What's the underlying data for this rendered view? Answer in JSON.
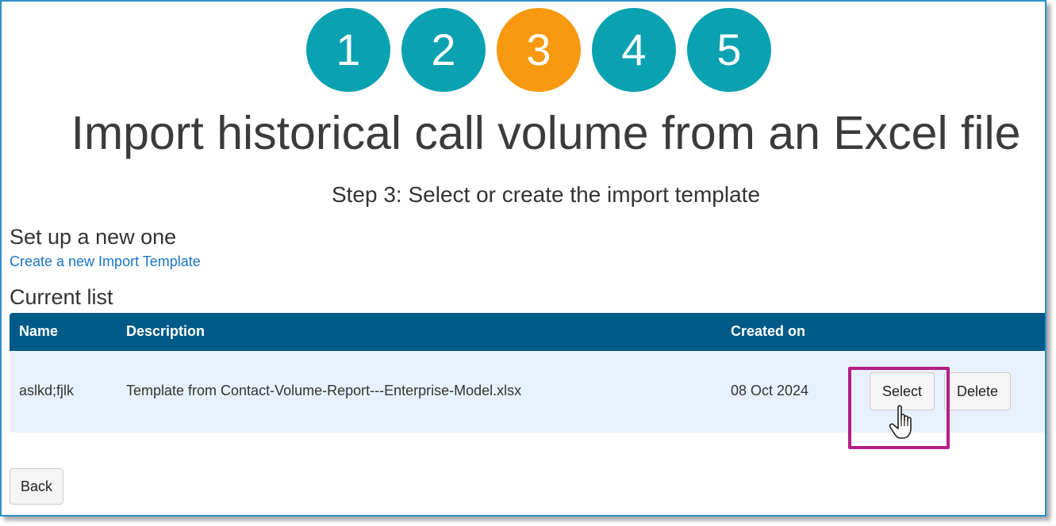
{
  "wizard": {
    "steps": [
      "1",
      "2",
      "3",
      "4",
      "5"
    ],
    "active_step": "3",
    "colors": {
      "step": "#0aa1b0",
      "active": "#f7980f"
    }
  },
  "title": "Import historical call volume from an Excel file",
  "subtitle": "Step 3: Select or create the import template",
  "new_section": {
    "heading": "Set up a new one",
    "link": "Create a new Import Template"
  },
  "list_section": {
    "heading": "Current list",
    "columns": [
      "Name",
      "Description",
      "Created on"
    ],
    "rows": [
      {
        "name": "aslkd;fjlk",
        "description": "Template from Contact-Volume-Report---Enterprise-Model.xlsx",
        "created_on": "08 Oct 2024",
        "select_label": "Select",
        "delete_label": "Delete"
      }
    ]
  },
  "back_label": "Back",
  "colors": {
    "header": "#005a87",
    "row_bg": "#e8f1fb",
    "link": "#1a73c8",
    "highlight": "#b51d86"
  },
  "icons": {
    "cursor": "hand-pointer-icon"
  }
}
